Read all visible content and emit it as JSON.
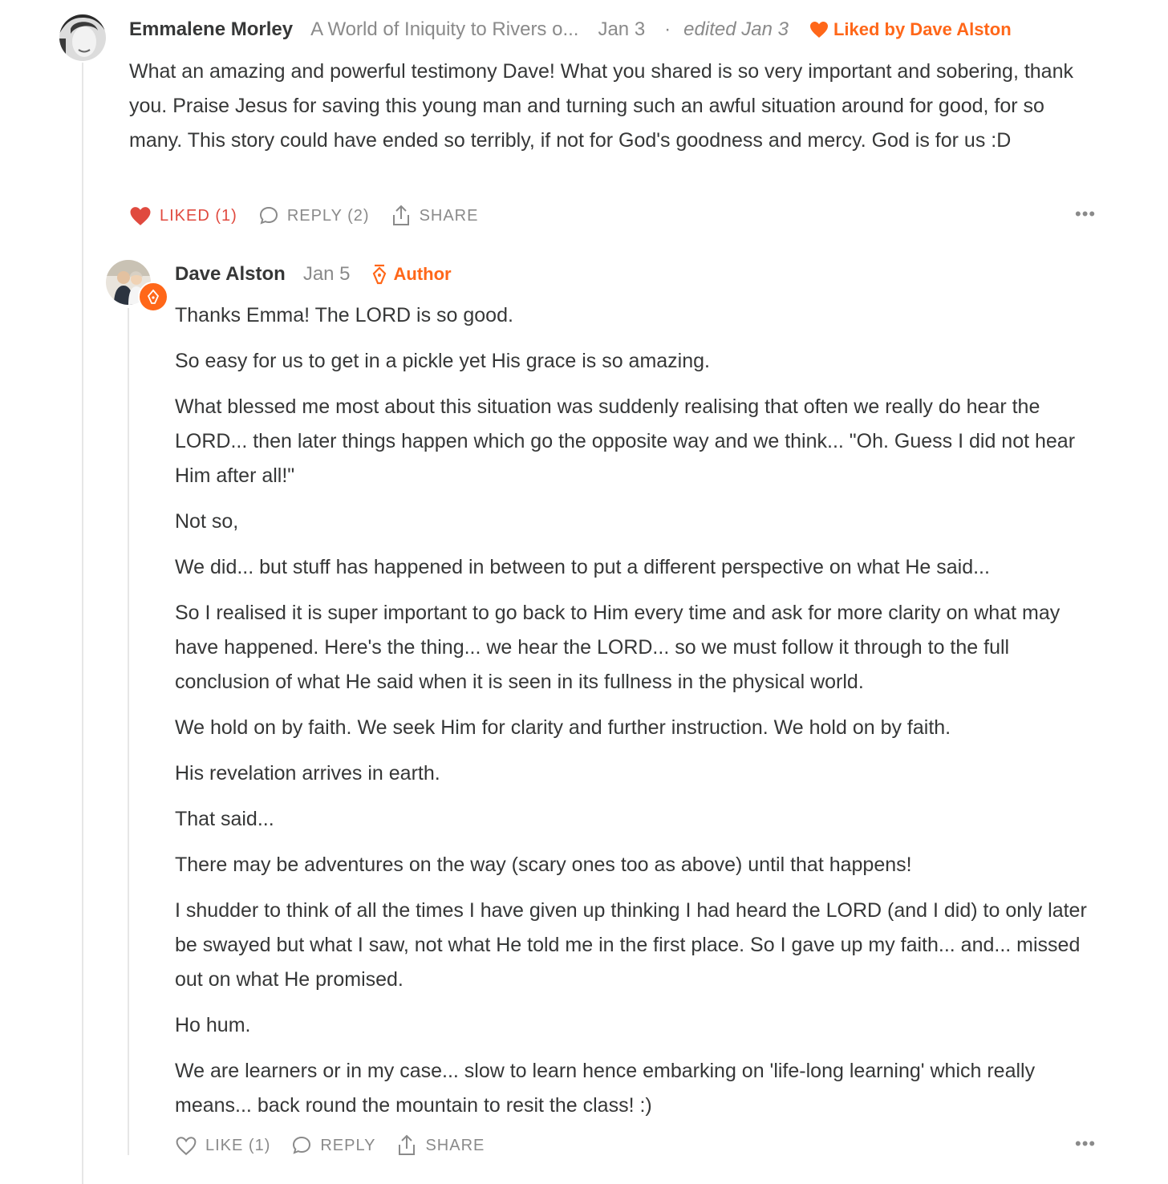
{
  "comments": [
    {
      "author": "Emmalene Morley",
      "post_title": "A World of Iniquity to Rivers o...",
      "date": "Jan 3",
      "separator": "·",
      "edited": "edited Jan 3",
      "liked_by": "Liked by Dave Alston",
      "paragraphs": [
        "What an amazing and powerful testimony Dave! What you shared is so very important and sobering, thank you. Praise Jesus for saving this young man and turning such an awful situation around for good, for so many. This story could have ended so terribly, if not for God's goodness and mercy. God is for us :D"
      ],
      "actions": {
        "like": "LIKED (1)",
        "reply": "REPLY (2)",
        "share": "SHARE",
        "more": "•••"
      }
    },
    {
      "author": "Dave Alston",
      "date": "Jan 5",
      "badge": "Author",
      "paragraphs": [
        "Thanks Emma! The LORD is so good.",
        "So easy for us to get in a pickle yet His grace is so amazing.",
        "What blessed me most about this situation was suddenly realising that often we really do hear the LORD... then later things happen which go the opposite way and we think... \"Oh. Guess I did not hear Him after all!\"",
        "Not so,",
        "We did... but stuff has happened in between to put a different perspective on what He said...",
        "So I realised it is super important to go back to Him every time and ask for more clarity on what may have happened. Here's the thing... we hear the LORD... so we must follow it through to the full conclusion of what He said when it is seen in its fullness in the physical world.",
        "We hold on by faith. We seek Him for clarity and further instruction. We hold on by faith.",
        "His revelation arrives in earth.",
        "That said...",
        "There may be adventures on the way (scary ones too as above) until that happens!",
        "I shudder to think of all the times I have given up thinking I had heard the LORD (and I did) to only later be swayed but what I saw, not what He told me in the first place. So I gave up my faith... and... missed out on what He promised.",
        "Ho hum.",
        "We are learners or in my case... slow to learn hence embarking on 'life-long learning' which really means... back round the mountain to resit the class! :)"
      ],
      "actions": {
        "like": "LIKE (1)",
        "reply": "REPLY",
        "share": "SHARE",
        "more": "•••"
      }
    }
  ],
  "colors": {
    "accent": "#ff6719",
    "liked": "#e04a3f",
    "muted": "#8a8a8a",
    "text": "#363737"
  }
}
